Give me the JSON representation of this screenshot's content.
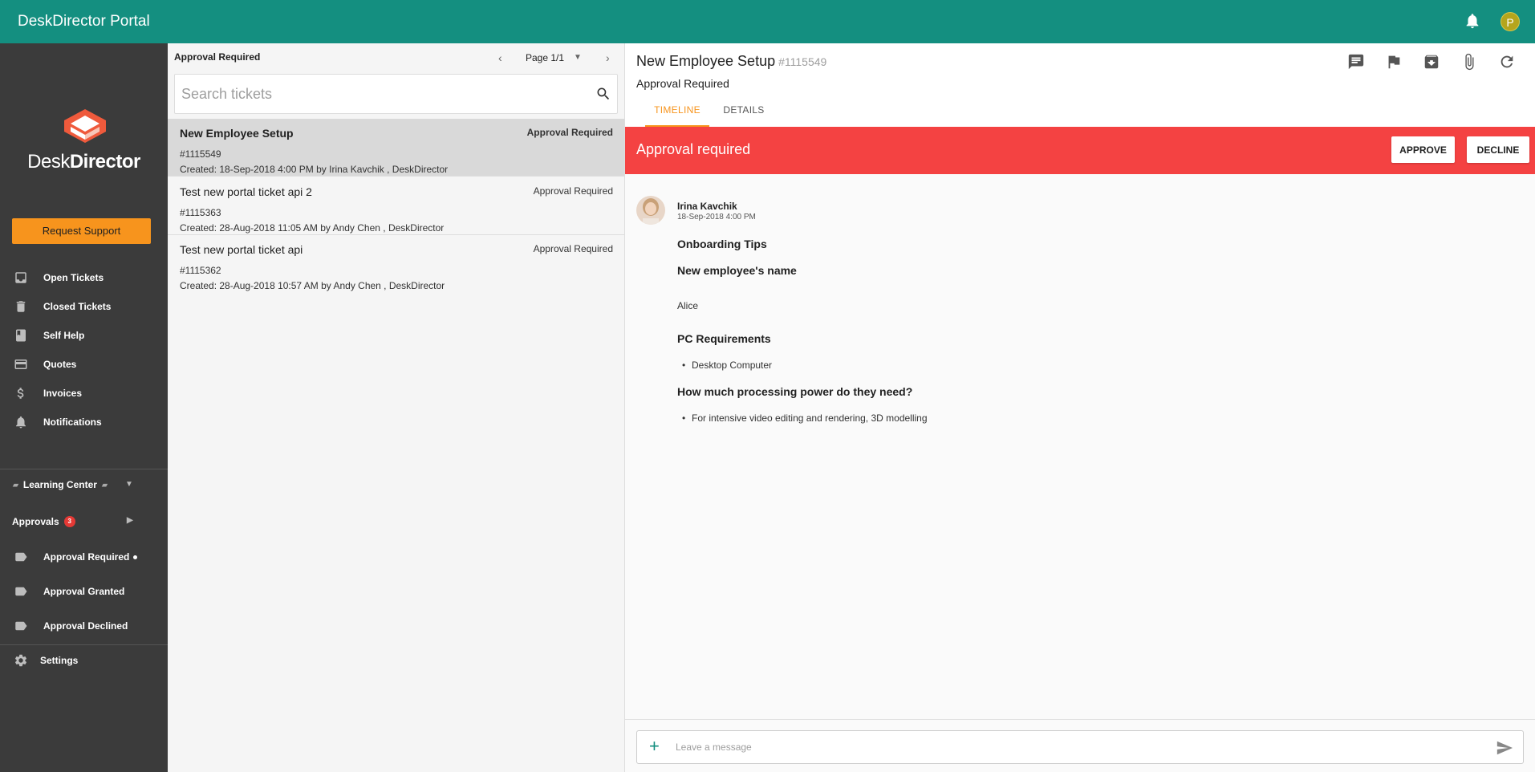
{
  "app": {
    "title": "DeskDirector Portal",
    "user_initial": "P"
  },
  "sidebar": {
    "logo_text_a": "Desk",
    "logo_text_b": "Director",
    "request_button": "Request Support",
    "nav": [
      {
        "label": "Open Tickets",
        "icon": "inbox-icon"
      },
      {
        "label": "Closed Tickets",
        "icon": "trash-icon"
      },
      {
        "label": "Self Help",
        "icon": "book-icon"
      },
      {
        "label": "Quotes",
        "icon": "card-icon"
      },
      {
        "label": "Invoices",
        "icon": "dollar-icon"
      },
      {
        "label": "Notifications",
        "icon": "bell-icon"
      }
    ],
    "learning_center": "Learning Center",
    "approvals": {
      "label": "Approvals",
      "count": "3"
    },
    "approval_items": [
      {
        "label": "Approval Required",
        "icon": "tag-icon"
      },
      {
        "label": "Approval Granted",
        "icon": "tag-icon"
      },
      {
        "label": "Approval Declined",
        "icon": "tag-icon"
      }
    ],
    "settings": "Settings"
  },
  "list": {
    "heading": "Approval Required",
    "page_label": "Page 1/1",
    "search_placeholder": "Search tickets",
    "tickets": [
      {
        "title": "New Employee Setup",
        "status": "Approval Required",
        "number": "#1115549",
        "created": "Created: 18-Sep-2018 4:00 PM by Irina Kavchik , DeskDirector"
      },
      {
        "title": "Test new portal ticket api 2",
        "status": "Approval Required",
        "number": "#1115363",
        "created": "Created: 28-Aug-2018 11:05 AM by Andy Chen , DeskDirector"
      },
      {
        "title": "Test new portal ticket api",
        "status": "Approval Required",
        "number": "#1115362",
        "created": "Created: 28-Aug-2018 10:57 AM by Andy Chen , DeskDirector"
      }
    ]
  },
  "detail": {
    "title": "New Employee Setup",
    "number": "#1115549",
    "status": "Approval Required",
    "tabs": [
      "TIMELINE",
      "DETAILS"
    ],
    "approval_banner": "Approval required",
    "approve_label": "APPROVE",
    "decline_label": "DECLINE",
    "entry": {
      "author": "Irina Kavchik",
      "date": "18-Sep-2018 4:00 PM",
      "heading_tips": "Onboarding Tips",
      "q_name": "New employee's name",
      "a_name": "Alice",
      "q_pc": "PC Requirements",
      "a_pc": "Desktop Computer",
      "q_power": "How much processing power do they need?",
      "a_power": "For intensive video editing and rendering, 3D modelling"
    },
    "message_placeholder": "Leave a message"
  }
}
